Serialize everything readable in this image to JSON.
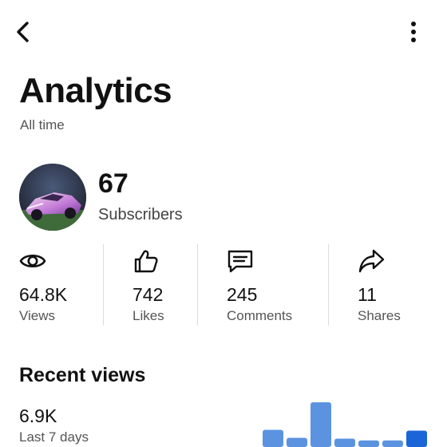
{
  "header": {
    "back_icon": "chevron-left-icon",
    "more_icon": "more-vertical-icon",
    "title": "Analytics",
    "subtitle": "All time"
  },
  "channel": {
    "subscribers": "67",
    "subscribers_label": "Subscribers"
  },
  "stats": [
    {
      "icon": "eye-icon",
      "value": "64.8K",
      "label": "Views"
    },
    {
      "icon": "thumbs-up-icon",
      "value": "742",
      "label": "Likes"
    },
    {
      "icon": "comment-icon",
      "value": "245",
      "label": "Comments"
    },
    {
      "icon": "share-icon",
      "value": "11",
      "label": "Shares"
    }
  ],
  "recent": {
    "title": "Recent views",
    "value": "6.9K",
    "period": "Last 7 days"
  },
  "chart_data": {
    "type": "bar",
    "values": [
      14,
      5,
      45,
      4,
      2,
      2,
      13
    ],
    "colors": {
      "normal": "#5b93e0",
      "highlight": "#1a66d9"
    },
    "highlight_index": 6
  }
}
